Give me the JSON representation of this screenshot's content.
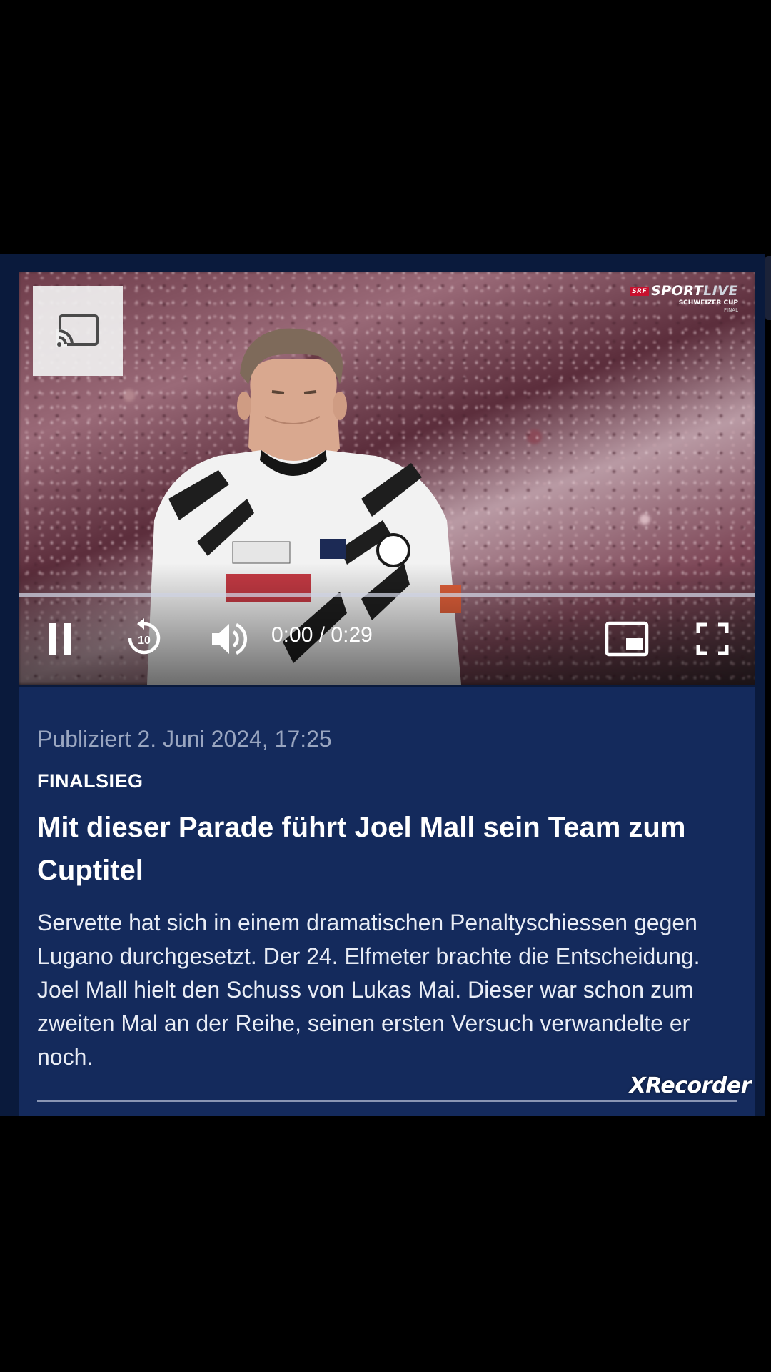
{
  "video": {
    "broadcaster": {
      "badge": "SRF",
      "brand_main": "SPORT",
      "brand_live": "LIVE",
      "event": "SCHWEIZER CUP",
      "stage": "FINAL"
    },
    "current_time": "0:00",
    "separator": "/",
    "duration": "0:29",
    "progress_fraction": 0.0,
    "controls": {
      "cast": "cast-icon",
      "pause": "pause-icon",
      "rewind": "rewind-10-icon",
      "rewind_label": "10",
      "volume": "volume-icon",
      "pip": "picture-in-picture-icon",
      "fullscreen": "fullscreen-icon"
    }
  },
  "article": {
    "published": "Publiziert 2. Juni 2024, 17:25",
    "kicker": "FINALSIEG",
    "headline": "Mit dieser Parade führt Joel Mall sein Team zum Cuptitel",
    "body": "Servette hat sich in einem dramatischen Penaltyschiessen gegen Lugano durchgesetzt. Der 24. Elfmeter brachte die Entscheidung. Joel Mall hielt den Schuss von Lukas Mai. Dieser war schon zum zweiten Mal an der Reihe, seinen ersten Versuch verwandelte er noch."
  },
  "watermark": "XRecorder",
  "colors": {
    "page_background": "#000000",
    "card_background": "#142a5c",
    "published_text": "#9aa6c0",
    "brand_red": "#c8102e"
  }
}
